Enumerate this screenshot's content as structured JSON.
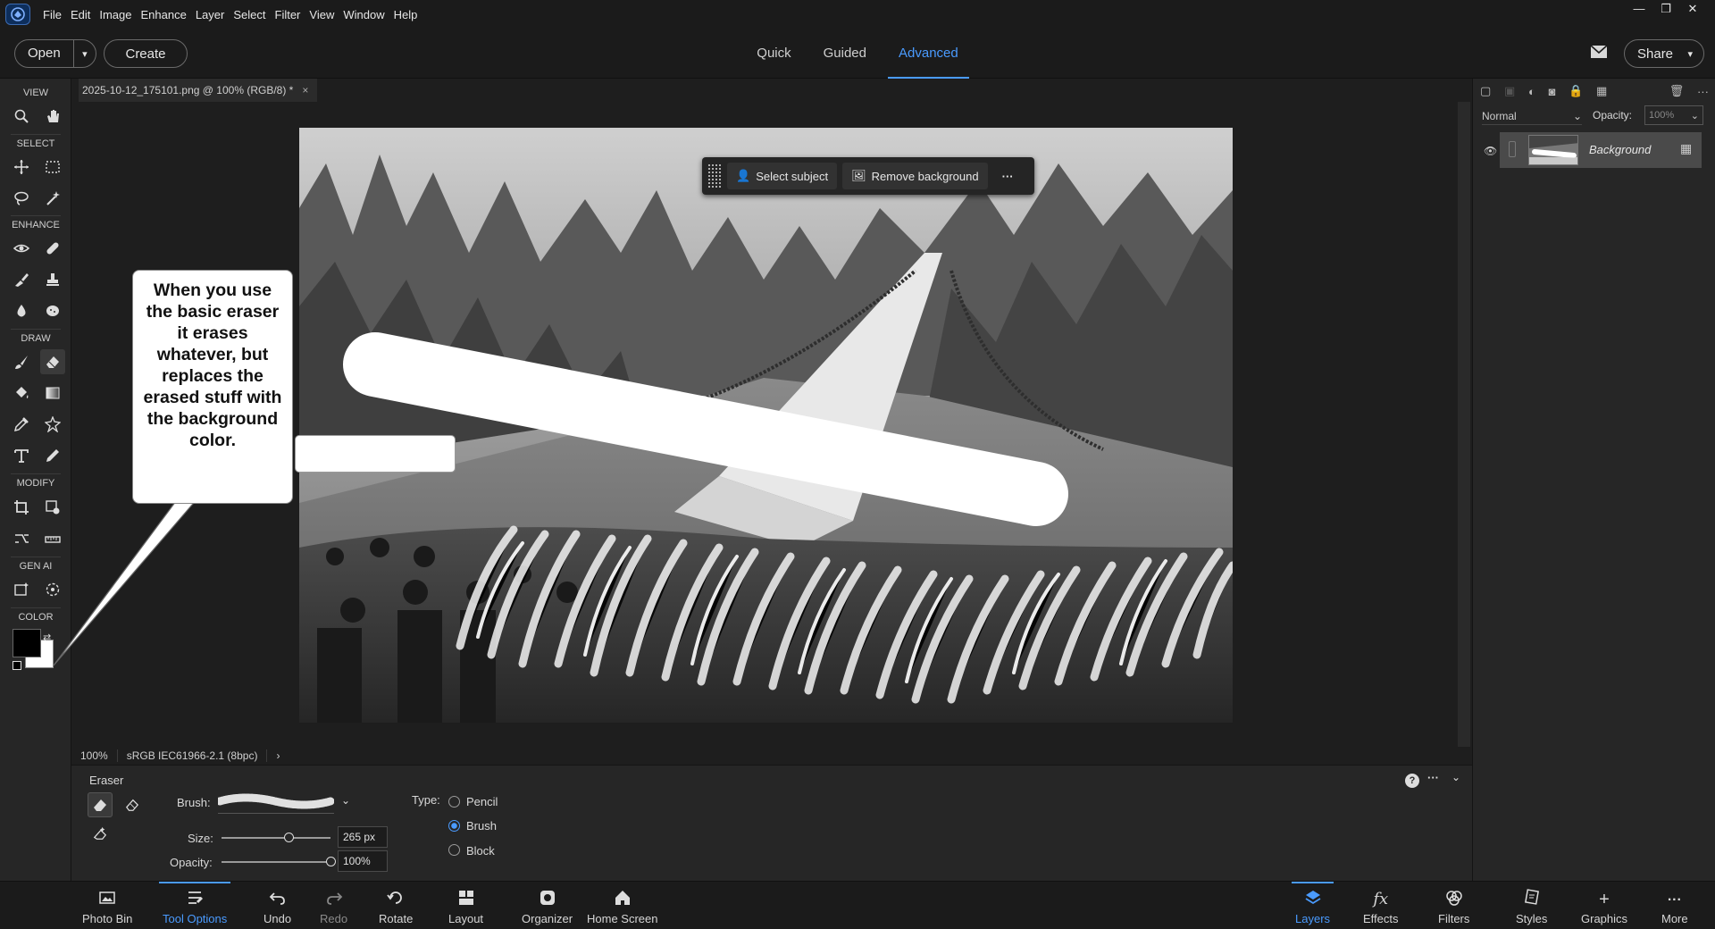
{
  "menubar": {
    "items": [
      "File",
      "Edit",
      "Image",
      "Enhance",
      "Layer",
      "Select",
      "Filter",
      "View",
      "Window",
      "Help"
    ],
    "window_controls": [
      "—",
      "❐",
      "✕"
    ]
  },
  "topbar": {
    "open_label": "Open",
    "create_label": "Create",
    "modes": [
      "Quick",
      "Guided",
      "Advanced"
    ],
    "active_mode": "Advanced",
    "share_label": "Share"
  },
  "toolbox": {
    "sections": [
      "VIEW",
      "SELECT",
      "ENHANCE",
      "DRAW",
      "MODIFY",
      "GEN AI",
      "COLOR"
    ],
    "foreground_color": "#000000",
    "background_color": "#ffffff"
  },
  "document": {
    "tab_title": "2025-10-12_175101.png @ 100% (RGB/8) *",
    "zoom": "100%",
    "color_profile": "sRGB IEC61966-2.1 (8bpc)"
  },
  "context_bar": {
    "select_subject": "Select subject",
    "remove_background": "Remove background"
  },
  "callout": {
    "text": "When you use the basic eraser it erases whatever, but replaces the erased stuff with the background color."
  },
  "tool_options": {
    "tool_name": "Eraser",
    "brush_label": "Brush:",
    "size_label": "Size:",
    "size_value": "265 px",
    "size_fraction": 0.62,
    "opacity_label": "Opacity:",
    "opacity_value": "100%",
    "opacity_fraction": 1.0,
    "type_label": "Type:",
    "types": [
      "Pencil",
      "Brush",
      "Block"
    ],
    "selected_type": "Brush"
  },
  "layers_panel": {
    "blend_mode": "Normal",
    "opacity_label": "Opacity:",
    "opacity_value": "100%",
    "layer_name": "Background"
  },
  "taskbar": {
    "left": [
      "Photo Bin",
      "Tool Options",
      "Undo",
      "Redo",
      "Rotate",
      "Layout",
      "Organizer",
      "Home Screen"
    ],
    "right": [
      "Layers",
      "Effects",
      "Filters",
      "Styles",
      "Graphics",
      "More"
    ],
    "active_left": "Tool Options",
    "active_right": "Layers",
    "accent": "#4a9bff"
  }
}
